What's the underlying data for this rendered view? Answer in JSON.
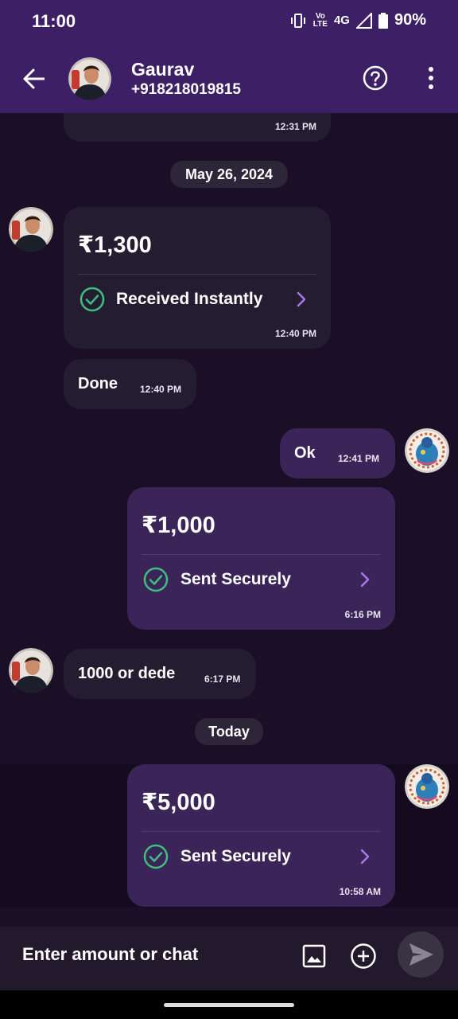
{
  "status_bar": {
    "time": "11:00",
    "network": "4G",
    "volte_top": "Vo",
    "volte_bottom": "LTE",
    "battery": "90%"
  },
  "header": {
    "contact_name": "Gaurav",
    "contact_phone": "+918218019815"
  },
  "chat": {
    "top_partial_time": "12:31 PM",
    "date_chip_1": "May 26, 2024",
    "payment_received": {
      "amount": "₹1,300",
      "status": "Received Instantly",
      "time": "12:40 PM"
    },
    "msg_done": {
      "text": "Done",
      "time": "12:40 PM"
    },
    "msg_ok": {
      "text": "Ok",
      "time": "12:41 PM"
    },
    "payment_sent_1": {
      "amount": "₹1,000",
      "status": "Sent Securely",
      "time": "6:16 PM"
    },
    "msg_dede": {
      "text": "1000 or dede",
      "time": "6:17 PM"
    },
    "date_chip_2": "Today",
    "payment_sent_2": {
      "amount": "₹5,000",
      "status": "Sent Securely",
      "time": "10:58 AM"
    }
  },
  "input": {
    "placeholder": "Enter amount or chat"
  },
  "colors": {
    "header_bg": "#3d1f66",
    "chat_bg": "#1a0f26",
    "incoming_bubble": "#241c30",
    "outgoing_bubble": "#3a2458",
    "success_green": "#3fbf7f",
    "chevron_purple": "#a678e8"
  }
}
